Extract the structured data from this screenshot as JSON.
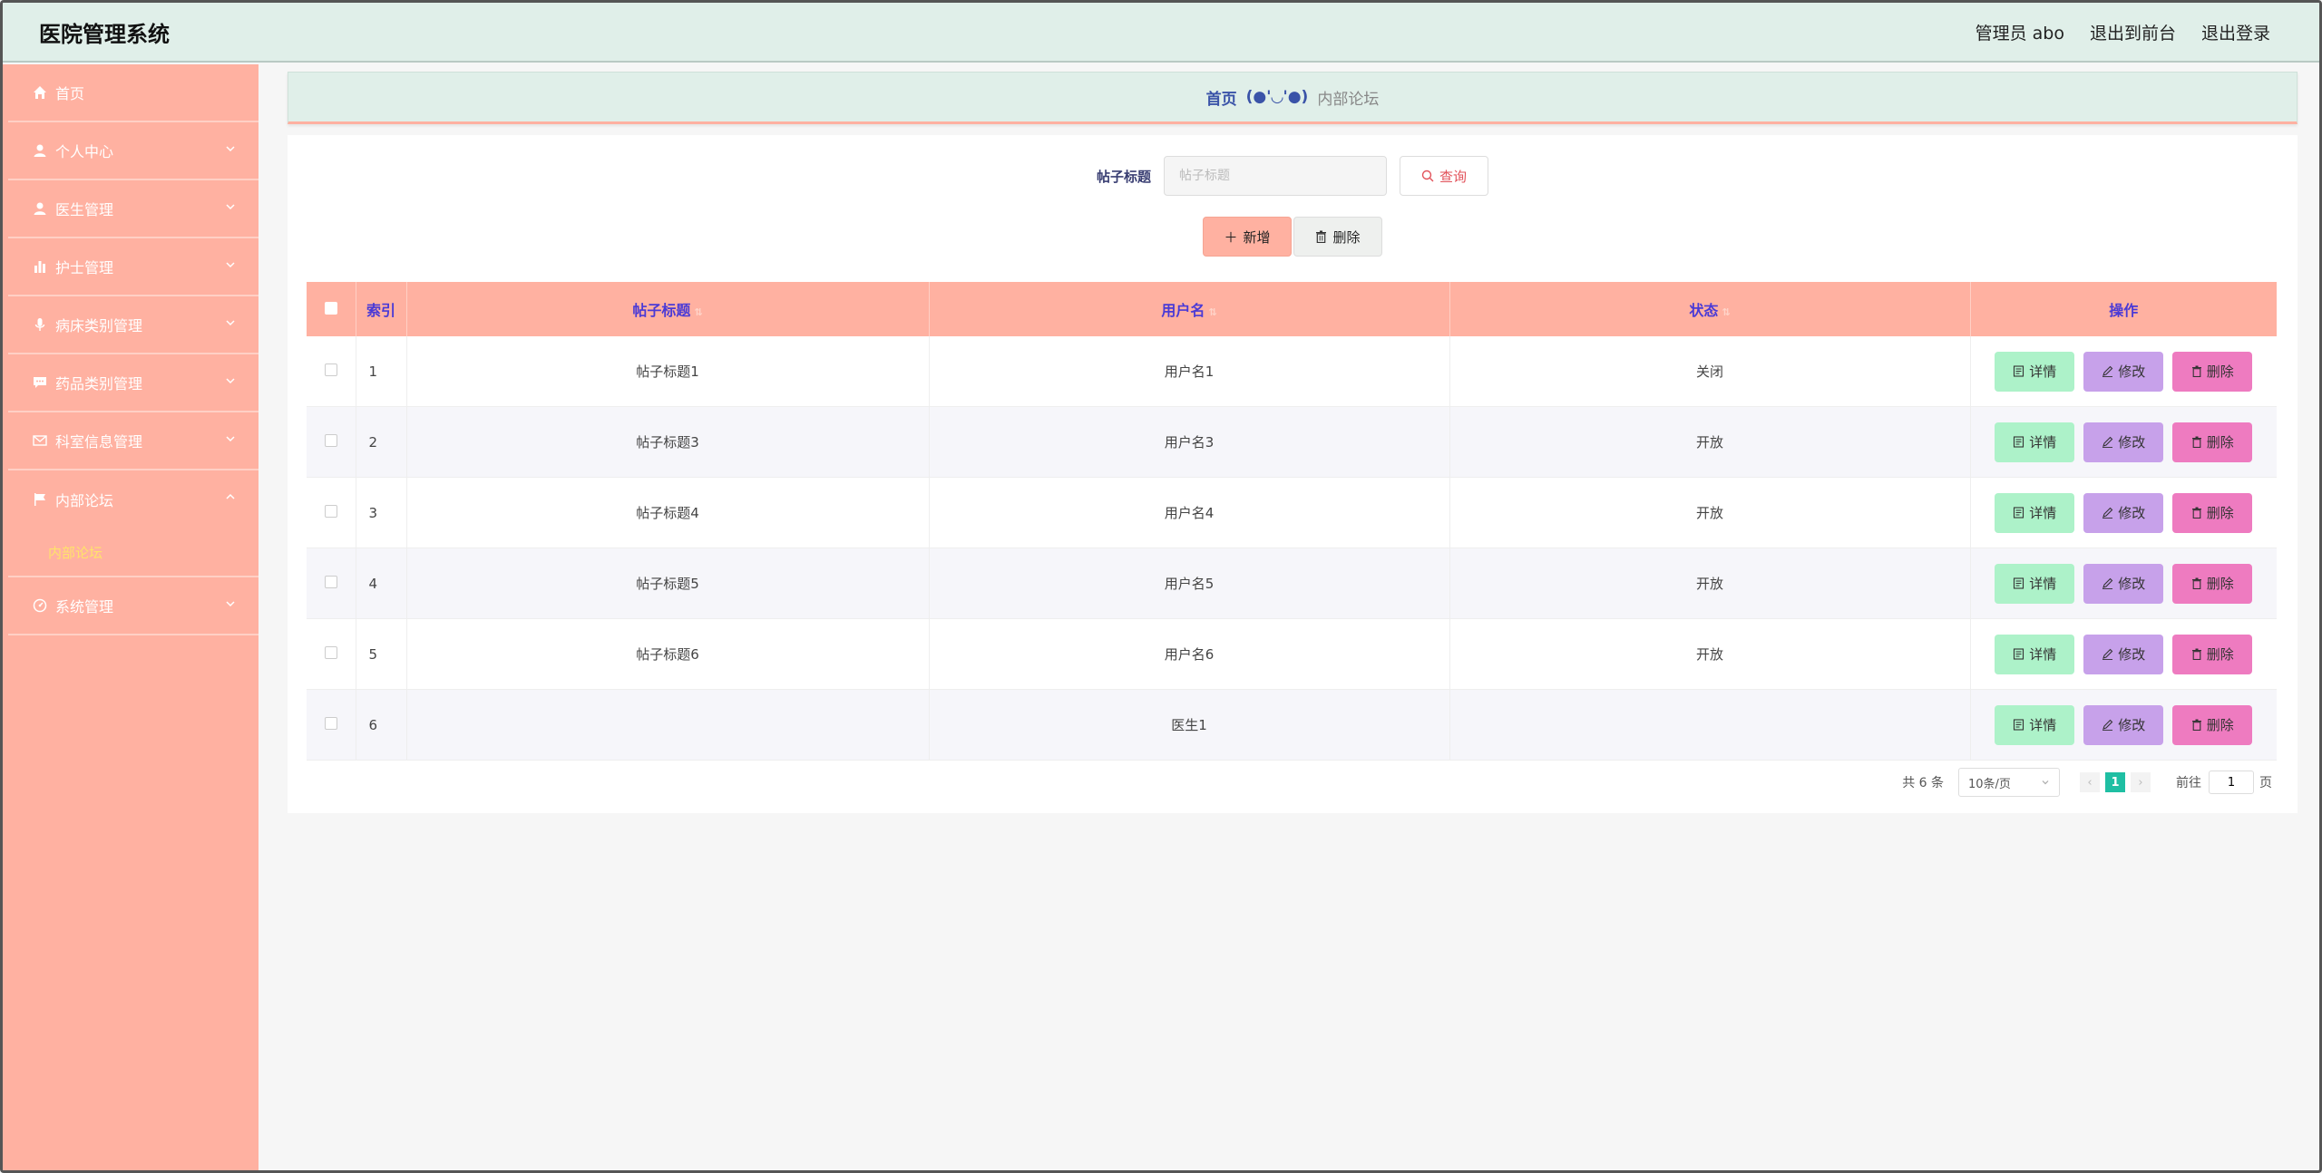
{
  "header": {
    "title": "医院管理系统",
    "user": "管理员 abo",
    "to_front": "退出到前台",
    "logout": "退出登录"
  },
  "sidebar": {
    "items": [
      {
        "label": "首页",
        "icon": "home-icon"
      },
      {
        "label": "个人中心",
        "icon": "user-icon"
      },
      {
        "label": "医生管理",
        "icon": "user-icon"
      },
      {
        "label": "护士管理",
        "icon": "bar-chart-icon"
      },
      {
        "label": "病床类别管理",
        "icon": "mic-icon"
      },
      {
        "label": "药品类别管理",
        "icon": "chat-icon"
      },
      {
        "label": "科室信息管理",
        "icon": "mail-icon"
      },
      {
        "label": "内部论坛",
        "icon": "flag-icon"
      },
      {
        "label": "系统管理",
        "icon": "gauge-icon"
      }
    ],
    "sub_item": "内部论坛"
  },
  "breadcrumb": {
    "home": "首页",
    "face": "(●'◡'●)",
    "current": "内部论坛"
  },
  "search": {
    "label": "帖子标题",
    "placeholder": "帖子标题",
    "button": "查询"
  },
  "actions": {
    "add": "新增",
    "delete": "删除"
  },
  "table": {
    "headers": [
      "索引",
      "帖子标题",
      "用户名",
      "状态",
      "操作"
    ],
    "rows": [
      {
        "index": "1",
        "title": "帖子标题1",
        "user": "用户名1",
        "status": "关闭"
      },
      {
        "index": "2",
        "title": "帖子标题3",
        "user": "用户名3",
        "status": "开放"
      },
      {
        "index": "3",
        "title": "帖子标题4",
        "user": "用户名4",
        "status": "开放"
      },
      {
        "index": "4",
        "title": "帖子标题5",
        "user": "用户名5",
        "status": "开放"
      },
      {
        "index": "5",
        "title": "帖子标题6",
        "user": "用户名6",
        "status": "开放"
      },
      {
        "index": "6",
        "title": "",
        "user": "医生1",
        "status": ""
      }
    ],
    "op_detail": "详情",
    "op_edit": "修改",
    "op_delete": "删除"
  },
  "pager": {
    "total": "共 6 条",
    "page_size": "10条/页",
    "current": "1",
    "goto_label": "前往",
    "goto_value": "1",
    "page_suffix": "页"
  },
  "colors": {
    "accent": "#ffb1a1",
    "header_bg": "#e0efe9",
    "detail": "#adf2c9",
    "edit": "#c7a1ea",
    "delete": "#ee7bc0",
    "page_active": "#1fbfa3"
  }
}
